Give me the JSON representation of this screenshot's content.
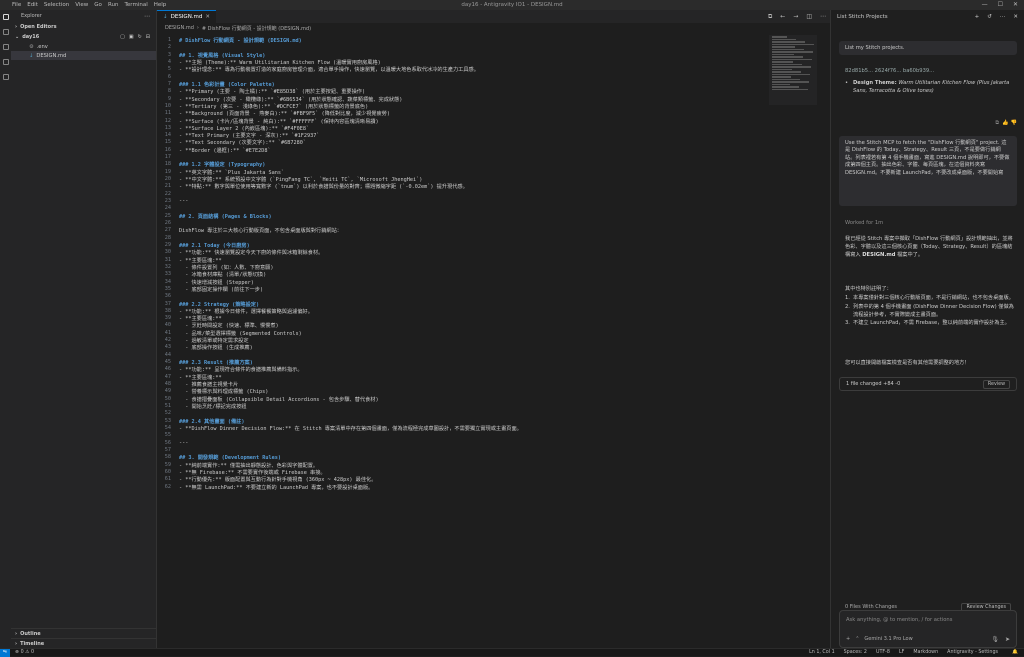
{
  "menu": [
    "File",
    "Edit",
    "Selection",
    "View",
    "Go",
    "Run",
    "Terminal",
    "Help"
  ],
  "window_title": "day16 - Antigravity IO1 - DESIGN.md",
  "sidebar": {
    "title": "Explorer",
    "open_editors": "Open Editors",
    "folder": "day16",
    "files": [
      ".env",
      "DESIGN.md"
    ],
    "outline": "Outline",
    "timeline": "Timeline"
  },
  "tab": {
    "label": "DESIGN.md"
  },
  "breadcrumb": [
    "DESIGN.md",
    "# DishFlow 行動網頁 - 設計規範 (DESIGN.md)"
  ],
  "code_lines": [
    {
      "n": "1",
      "t": "# DishFlow 行動網頁 - 設計規範 (DESIGN.md)",
      "k": "h"
    },
    {
      "n": "2",
      "t": "",
      "k": "txt"
    },
    {
      "n": "3",
      "t": "## 1. 視覺風格 (Visual Style)",
      "k": "h"
    },
    {
      "n": "4",
      "t": "- **主題 (Theme):** Warm Utilitarian Kitchen Flow (溫暖實用廚房風格)",
      "k": "li"
    },
    {
      "n": "5",
      "t": "- **設計理念:** 專為行動裝置打造的家庭廚房管理介面，適合單手操作，快速瀏覽，以溫暖大地色系取代冰冷的生產力工具感。",
      "k": "li"
    },
    {
      "n": "6",
      "t": "",
      "k": "txt"
    },
    {
      "n": "7",
      "t": "### 1.1 色彩計畫 (Color Palette)",
      "k": "h"
    },
    {
      "n": "8",
      "t": "- **Primary (主要 - 陶土橘):** `#E85D38` (用於主要按鈕、重要操作)",
      "k": "li"
    },
    {
      "n": "9",
      "t": "- **Secondary (次要 - 橄欖綠):** `#6B6534` (用於狀態確認、蔬菜類標籤、完成狀態)",
      "k": "li"
    },
    {
      "n": "10",
      "t": "- **Tertiary (第三 - 淺綠色):** `#DCFCE7` (用於狀態標籤的背景底色)",
      "k": "li"
    },
    {
      "n": "11",
      "t": "- **Background (頁面背景 - 燕麥白):** `#FBF9F5` (降低對比度，減少視覺疲勞)",
      "k": "li"
    },
    {
      "n": "12",
      "t": "- **Surface (卡片/區塊背景 - 純白):** `#FFFFFF` (保持內容區塊清晰易讀)",
      "k": "li"
    },
    {
      "n": "13",
      "t": "- **Surface Layer 2 (內嵌區塊):** `#F4F0E8`",
      "k": "li"
    },
    {
      "n": "14",
      "t": "- **Text Primary (主要文字 - 深灰):** `#1F2937`",
      "k": "li"
    },
    {
      "n": "15",
      "t": "- **Text Secondary (次要文字):** `#6B7280`",
      "k": "li"
    },
    {
      "n": "16",
      "t": "- **Border (邊框):** `#E7E2D8`",
      "k": "li"
    },
    {
      "n": "17",
      "t": "",
      "k": "txt"
    },
    {
      "n": "18",
      "t": "### 1.2 字體設定 (Typography)",
      "k": "h"
    },
    {
      "n": "19",
      "t": "- **英文字體:** `Plus Jakarta Sans`",
      "k": "li"
    },
    {
      "n": "20",
      "t": "- **中文字體:** 系統預設中文字體 (`PingFang TC`, `Heiti TC`, `Microsoft JhengHei`)",
      "k": "li"
    },
    {
      "n": "21",
      "t": "- **特點:** 數字與單位使用等寬數字 (`tnum`) 以利於食譜與份量的對齊；標題微縮字距 (`-0.02em`) 提升現代感。",
      "k": "li"
    },
    {
      "n": "22",
      "t": "",
      "k": "txt"
    },
    {
      "n": "23",
      "t": "---",
      "k": "txt"
    },
    {
      "n": "24",
      "t": "",
      "k": "txt"
    },
    {
      "n": "25",
      "t": "## 2. 頁面結構 (Pages & Blocks)",
      "k": "h"
    },
    {
      "n": "26",
      "t": "",
      "k": "txt"
    },
    {
      "n": "27",
      "t": "DishFlow 專注於三大核心行動版頁面，不包含桌面版與對行銷網站：",
      "k": "txt"
    },
    {
      "n": "28",
      "t": "",
      "k": "txt"
    },
    {
      "n": "29",
      "t": "### 2.1 Today (今日廚房)",
      "k": "h"
    },
    {
      "n": "30",
      "t": "- **功能:** 快速瀏覽設定今天下廚的條件與冰箱剩餘食材。",
      "k": "li"
    },
    {
      "n": "31",
      "t": "- **主要區塊:**",
      "k": "li"
    },
    {
      "n": "32",
      "t": "  - 條件設置列 (如：人數、下廚意願)",
      "k": "li"
    },
    {
      "n": "33",
      "t": "  - 冰箱食材庫點 (清單/狀態切換)",
      "k": "li"
    },
    {
      "n": "34",
      "t": "  - 快速增減按鈕 (Stepper)",
      "k": "li"
    },
    {
      "n": "35",
      "t": "  - 底部固定操作欄 (前往下一步)",
      "k": "li"
    },
    {
      "n": "36",
      "t": "",
      "k": "txt"
    },
    {
      "n": "37",
      "t": "### 2.2 Strategy (策略設定)",
      "k": "h"
    },
    {
      "n": "38",
      "t": "- **功能:** 根據今日條件，選擇餐餐策略與過濾偏好。",
      "k": "li"
    },
    {
      "n": "39",
      "t": "- **主要區塊:**",
      "k": "li"
    },
    {
      "n": "40",
      "t": "  - 烹飪時間設定 (快速、標準、慢慢煮)",
      "k": "li"
    },
    {
      "n": "41",
      "t": "  - 品味/菜型選擇標籤 (Segmented Controls)",
      "k": "li"
    },
    {
      "n": "42",
      "t": "  - 過敏清單或特定需求設定",
      "k": "li"
    },
    {
      "n": "43",
      "t": "  - 底部操作按鈕 (生成推薦)",
      "k": "li"
    },
    {
      "n": "44",
      "t": "",
      "k": "txt"
    },
    {
      "n": "45",
      "t": "### 2.3 Result (推薦方案)",
      "k": "h"
    },
    {
      "n": "46",
      "t": "- **功能:** 呈現符合條件的食譜推薦與備料指示。",
      "k": "li"
    },
    {
      "n": "47",
      "t": "- **主要區塊:**",
      "k": "li"
    },
    {
      "n": "48",
      "t": "  - 推薦食譜主視覺卡片",
      "k": "li"
    },
    {
      "n": "49",
      "t": "  - 營養標示與料理成標籤 (Chips)",
      "k": "li"
    },
    {
      "n": "50",
      "t": "  - 食譜摺疊面板 (Collapsible Detail Accordions - 包含步驟、替代食材)",
      "k": "li"
    },
    {
      "n": "51",
      "t": "  - 開始烹飪/標記完成按鈕",
      "k": "li"
    },
    {
      "n": "52",
      "t": "",
      "k": "txt"
    },
    {
      "n": "53",
      "t": "### 2.4 其他畫面 (備註)",
      "k": "h"
    },
    {
      "n": "54",
      "t": "- **DishFlow Dinner Decision Flow:** 在 Stitch 專案清單中存在第四個畫面，僅為流程極完成草圖設計，不需要獨立實現或主畫頁面。",
      "k": "li"
    },
    {
      "n": "55",
      "t": "",
      "k": "txt"
    },
    {
      "n": "56",
      "t": "---",
      "k": "txt"
    },
    {
      "n": "57",
      "t": "",
      "k": "txt"
    },
    {
      "n": "58",
      "t": "## 3. 開發規範 (Development Rules)",
      "k": "h"
    },
    {
      "n": "59",
      "t": "- **純前端實作:** 僅需抽出靜態設計、色彩與字體配置。",
      "k": "li"
    },
    {
      "n": "60",
      "t": "- **無 Firebase:** 不需要實作後端或 Firebase 串接。",
      "k": "li"
    },
    {
      "n": "61",
      "t": "- **行動優先:** 版面配置與互動行為針對手機視角 (360px ~ 428px) 最佳化。",
      "k": "li"
    },
    {
      "n": "62",
      "t": "- **無需 LaunchPad:** 不要建立新的 LaunchPad 專案，也不要設計桌面版。",
      "k": "li"
    }
  ],
  "chat": {
    "title": "List Stitch Projects",
    "msg1": "List my Stitch projects.",
    "ids": "82d81b5... 2624f76... ba60b939...",
    "design_theme_label": "Design Theme:",
    "design_theme_value": "Warm Utilitarian Kitchen Flow (Plus Jakarta Sans, Terracotta & Olive tones)",
    "msg2": "Use the Stitch MCP to fetch the \"DishFlow 行動網頁\" project. 這是 DishFlow 的 Today、Strategy、Result 三頁，不是要做行銷網站。列表裡若有第 4 個手機畫面，寫進 DESIGN.md 說明即可，不要做成第四個主頁。抽出色彩、字體、每頁區塊，在這個資料夾寫 DESIGN.md。不要新建 LaunchPad，不要改成桌面版，不要開始寫",
    "worked_for": "Worked for 1m",
    "response_intro": "我已經從 Stitch 專案中擷取「DishFlow 行動網頁」設計規範抽出，並將色彩、字體以及這三個核心頁面（Today、Strategy、Result）的區塊結構寫入",
    "response_file": "DESIGN.md",
    "response_tail": "檔案中了。",
    "key_points_title": "其中也特別註明了：",
    "points": [
      "本專案僅針對三個核心行動版頁面，不是行銷網站，也不包含桌面版。",
      "列表中的第 4 個手機畫面 (DishFlow Dinner Decision Flow) 僅做為流程設計參考，不實際變成主畫頁面。",
      "不建立 LaunchPad，不需 Firebase，整以純前端的實作設計為主。"
    ],
    "closing": "您可以直接開啟檔案檢查是否有其他需要調整的地方！",
    "files_changed": "1 file changed +84 -0",
    "review_label": "Review",
    "files_with_changes": "0 Files With Changes",
    "review_changes": "Review Changes",
    "input_placeholder": "Ask anything, @ to mention, / for actions",
    "model": "Gemini 3.1 Pro Low"
  },
  "status": {
    "position": "Ln 1, Col 1",
    "spaces": "Spaces: 2",
    "encoding": "UTF-8",
    "eol": "LF",
    "language": "Markdown",
    "settings": "Antigravity - Settings"
  }
}
